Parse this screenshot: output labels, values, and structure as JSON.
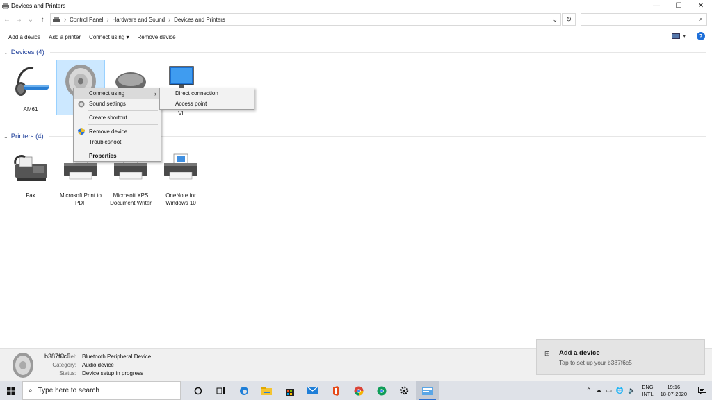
{
  "window": {
    "title": "Devices and Printers",
    "minimize": "—",
    "maximize": "☐",
    "close": "✕"
  },
  "nav": {
    "back": "←",
    "forward": "→",
    "recent": "⌄",
    "up": "↑"
  },
  "address": {
    "breadcrumbs": [
      "Control Panel",
      "Hardware and Sound",
      "Devices and Printers"
    ],
    "separator": "›",
    "dropdown": "⌄",
    "refresh": "↻"
  },
  "search": {
    "placeholder": "",
    "icon": "⌕"
  },
  "toolbar": {
    "add_device": "Add a device",
    "add_printer": "Add a printer",
    "connect_using": "Connect using ▾",
    "remove_device": "Remove device",
    "help": "?"
  },
  "groups": {
    "devices": {
      "title": "Devices (4)",
      "chevron": "⌄"
    },
    "printers": {
      "title": "Printers (4)",
      "chevron": "⌄"
    }
  },
  "devices": [
    {
      "label": "AM61",
      "icon": "headset-icon"
    },
    {
      "label": "b",
      "icon": "speaker-icon"
    },
    {
      "label": "",
      "icon": "mouse-icon"
    },
    {
      "label": "VI",
      "icon": "monitor-icon"
    }
  ],
  "printers": [
    {
      "label": "Fax",
      "icon": "fax-icon"
    },
    {
      "label": "Microsoft Print to PDF",
      "icon": "printer-icon"
    },
    {
      "label": "Microsoft XPS Document Writer",
      "icon": "printer-icon"
    },
    {
      "label": "OneNote for Windows 10",
      "icon": "printer-icon"
    }
  ],
  "context_menu": {
    "connect_using": "Connect using",
    "sound_settings": "Sound settings",
    "create_shortcut": "Create shortcut",
    "remove_device": "Remove device",
    "troubleshoot": "Troubleshoot",
    "properties": "Properties",
    "arrow": "›"
  },
  "submenu": {
    "direct_connection": "Direct connection",
    "access_point": "Access point"
  },
  "details": {
    "name": "b387f6c5",
    "model_label": "Model:",
    "model_value": "Bluetooth Peripheral Device",
    "category_label": "Category:",
    "category_value": "Audio device",
    "status_label": "Status:",
    "status_value": "Device setup in progress"
  },
  "toast": {
    "title": "Add a device",
    "subtitle": "Tap to set up your b387f6c5"
  },
  "taskbar": {
    "search_text": "Type here to search",
    "search_icon": "⌕",
    "language_top": "ENG",
    "language_bottom": "INTL",
    "time": "19:16",
    "date": "18-07-2020",
    "tray_chevron": "⌃"
  },
  "colors": {
    "group_title": "#1e3f9a",
    "selection": "#cce8ff",
    "taskbar": "#dfe2e8",
    "accent": "#2d6fd0"
  }
}
